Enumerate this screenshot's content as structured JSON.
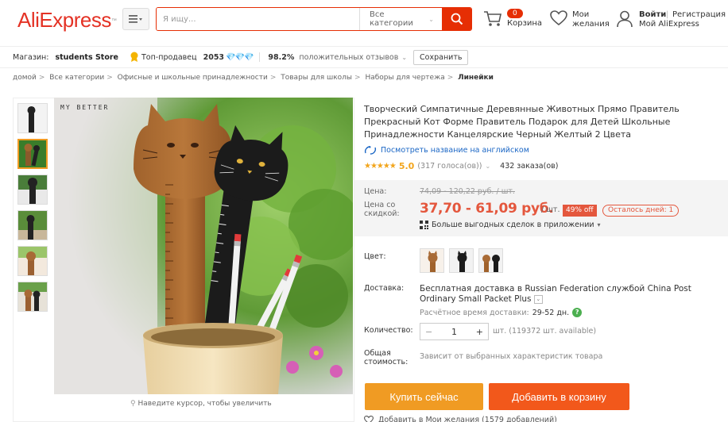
{
  "header": {
    "logo": "AliExpress",
    "search_placeholder": "Я ищу...",
    "category_select": "Все категории",
    "cart_count": "0",
    "cart_label": "Корзина",
    "wishlist_line1": "Мои",
    "wishlist_line2": "желания",
    "login": "Войти",
    "register": "Регистрация",
    "my_account": "Мой AliExpress"
  },
  "store": {
    "label": "Магазин:",
    "name": "students Store",
    "seller_badge": "Топ-продавец",
    "score": "2053",
    "gems": "💎💎💎",
    "positive_pct": "98.2%",
    "positive_label": "положительных отзывов",
    "save_button": "Сохранить"
  },
  "breadcrumbs": [
    "домой",
    "Все категории",
    "Офисные и школьные принадлежности",
    "Товары для школы",
    "Наборы для чертежа",
    "Линейки"
  ],
  "gallery": {
    "watermark": "MY BETTER",
    "zoom_hint": "Наведите курсор, чтобы увеличить",
    "thumbnail_count": 6,
    "active_index": 1
  },
  "product": {
    "title": "Творческий Симпатичные Деревянные Животных Прямо Правитель Прекрасный Кот Форме Правитель Подарок для Детей Школьные Принадлежности Канцелярские Черный Желтый 2 Цвета",
    "translate_link": "Посмотреть название на английском",
    "stars": "★★★★★",
    "rating": "5.0",
    "votes": "(317 голоса(ов))",
    "orders": "432 заказа(ов)",
    "price_label": "Цена:",
    "old_price": "74,09 - 120,22 руб. / шт.",
    "sale_label_1": "Цена со",
    "sale_label_2": "скидкой:",
    "sale_price": "37,70 - 61,09 руб.",
    "per_unit": "/ шт.",
    "discount": "49% off",
    "days_left": "Осталось дней: 1",
    "app_deals": "Больше выгодных сделок в приложении",
    "color_label": "Цвет:",
    "delivery_label": "Доставка:",
    "delivery_text_1": "Бесплатная доставка в",
    "delivery_text_2": "Russian Federation службой China Post Ordinary Small Packet Plus",
    "eta_label": "Расчётное время доставки:",
    "eta_days": "29-52 дн.",
    "qty_label": "Количество:",
    "qty_minus": "−",
    "qty_value": "1",
    "qty_plus": "+",
    "stock": "шт. (119372 шт. available)",
    "total_label_1": "Общая",
    "total_label_2": "стоимость:",
    "total_value": "Зависит от выбранных характеристик товара",
    "buy_now": "Купить сейчас",
    "add_to_cart": "Добавить в корзину",
    "bottom_cut": "Добавить в Мои желания (1579 добавлений)"
  },
  "colors": {
    "brand": "#e43225",
    "price": "#e4573d",
    "buy_button": "#f09b23",
    "cart_button": "#f2581b",
    "link": "#1a66c5",
    "star": "#f2a51c"
  }
}
